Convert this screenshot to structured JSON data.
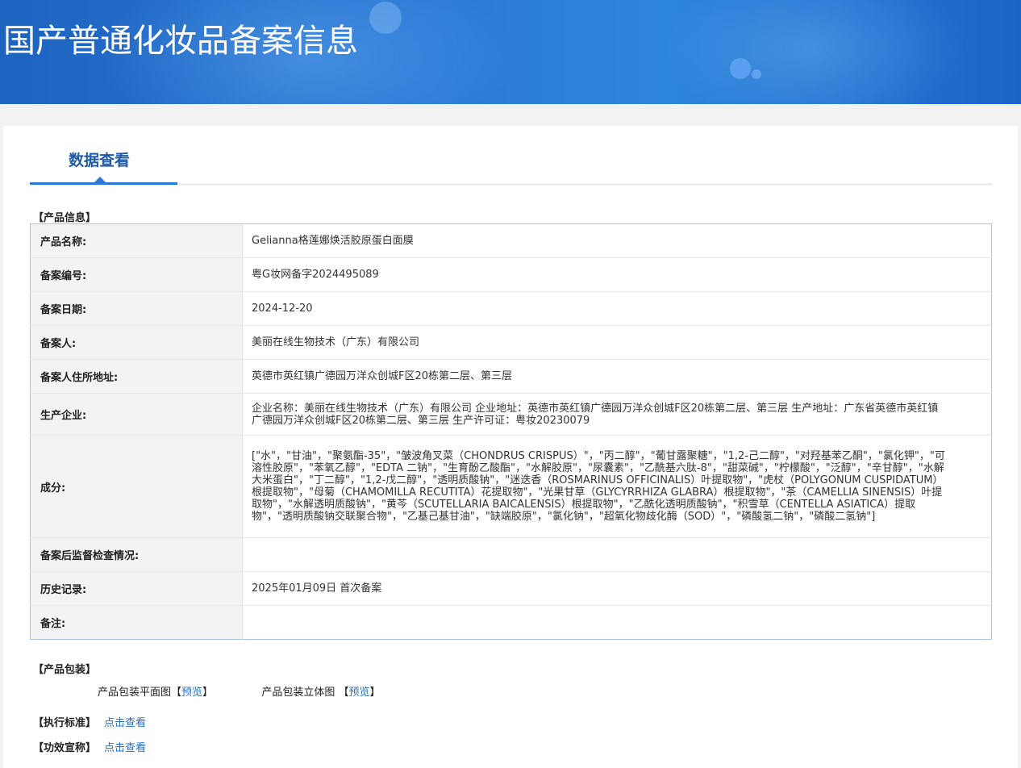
{
  "page_title": "国产普通化妆品备案信息",
  "tab": {
    "label": "数据查看"
  },
  "product_info": {
    "section_label": "【产品信息】",
    "rows": [
      {
        "label": "产品名称:",
        "value": "Gelianna格莲娜焕活胶原蛋白面膜"
      },
      {
        "label": "备案编号:",
        "value": "粤G妆网备字2024495089"
      },
      {
        "label": "备案日期:",
        "value": "2024-12-20"
      },
      {
        "label": "备案人:",
        "value": "美丽在线生物技术（广东）有限公司"
      },
      {
        "label": "备案人住所地址:",
        "value": "英德市英红镇广德园万洋众创城F区20栋第二层、第三层"
      },
      {
        "label": "生产企业:",
        "value": "企业名称：美丽在线生物技术（广东）有限公司 企业地址：英德市英红镇广德园万洋众创城F区20栋第二层、第三层 生产地址：广东省英德市英红镇广德园万洋众创城F区20栋第二层、第三层 生产许可证：粤妆20230079"
      },
      {
        "label": "成分:",
        "value": "[\"水\"，\"甘油\"，\"聚氨酯-35\"，\"皱波角叉菜（CHONDRUS CRISPUS）\"，\"丙二醇\"，\"葡甘露聚糖\"，\"1,2-己二醇\"，\"对羟基苯乙酮\"，\"氯化钾\"，\"可溶性胶原\"，\"苯氧乙醇\"，\"EDTA 二钠\"，\"生育酚乙酸酯\"，\"水解胶原\"，\"尿囊素\"，\"乙酰基六肽-8\"，\"甜菜碱\"，\"柠檬酸\"，\"泛醇\"，\"辛甘醇\"，\"水解大米蛋白\"，\"丁二醇\"，\"1,2-戊二醇\"，\"透明质酸钠\"，\"迷迭香（ROSMARINUS OFFICINALIS）叶提取物\"，\"虎杖（POLYGONUM CUSPIDATUM）根提取物\"，\"母菊（CHAMOMILLA RECUTITA）花提取物\"，\"光果甘草（GLYCYRRHIZA GLABRA）根提取物\"，\"茶（CAMELLIA SINENSIS）叶提取物\"，\"水解透明质酸钠\"，\"黄芩（SCUTELLARIA BAICALENSIS）根提取物\"，\"乙酰化透明质酸钠\"，\"积雪草（CENTELLA ASIATICA）提取物\"，\"透明质酸钠交联聚合物\"，\"乙基己基甘油\"，\"缺端胶原\"，\"氯化钠\"，\"超氧化物歧化酶（SOD）\"，\"磷酸氢二钠\"，\"磷酸二氢钠\"]"
      },
      {
        "label": "备案后监督检查情况:",
        "value": ""
      },
      {
        "label": "历史记录:",
        "value": "2025年01月09日 首次备案"
      },
      {
        "label": "备注:",
        "value": ""
      }
    ]
  },
  "packaging": {
    "section_label": "【产品包装】",
    "flat_label": "产品包装平面图",
    "flat_bracket_open": "【",
    "flat_link": "预览",
    "flat_bracket_close": "】",
    "solid_label": "产品包装立体图",
    "solid_bracket_open": "【",
    "solid_link": "预览",
    "solid_bracket_close": "】"
  },
  "standard": {
    "label": "【执行标准】",
    "link": "点击查看"
  },
  "efficacy": {
    "label": "【功效宣称】",
    "link": "点击查看"
  }
}
